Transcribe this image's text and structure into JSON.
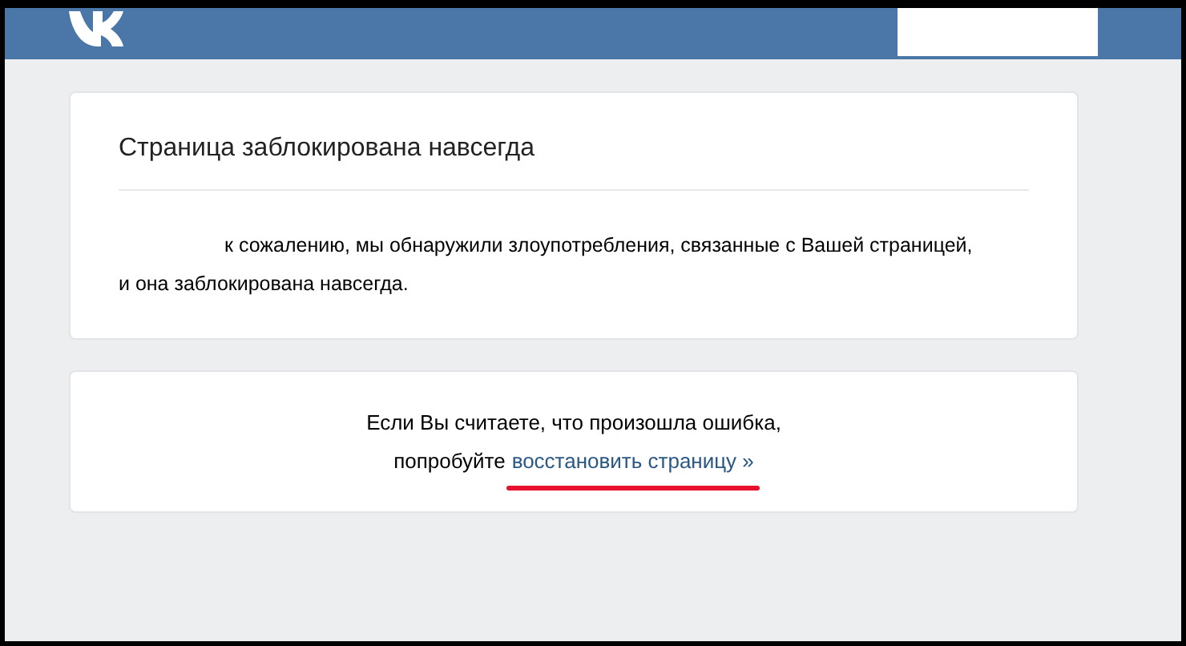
{
  "blocked_card": {
    "title": "Страница заблокирована навсегда",
    "message": "к сожалению, мы обнаружили злоупотребления, связанные с Вашей страницей,\nи она заблокирована навсегда."
  },
  "restore_card": {
    "text": "Если Вы считаете, что произошла ошибка,",
    "prefix": "попробуйте",
    "link": "восстановить страницу »",
    "underlined": true
  }
}
